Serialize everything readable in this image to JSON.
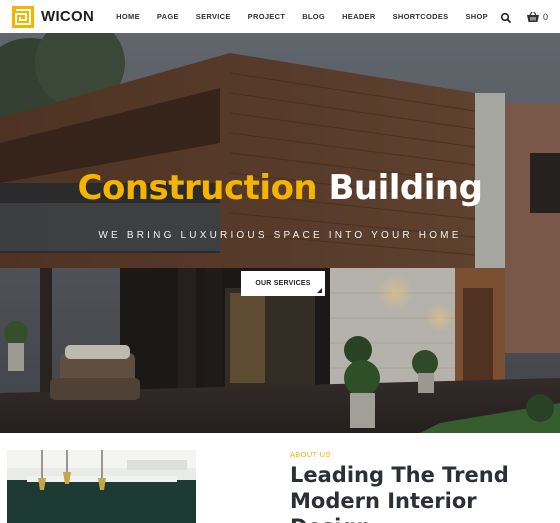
{
  "header": {
    "logo_text": "WICON",
    "logo_icon": "wicon-logo-mark",
    "nav": [
      "HOME",
      "PAGE",
      "SERVICE",
      "PROJECT",
      "BLOG",
      "HEADER",
      "SHORTCODES",
      "SHOP"
    ],
    "cart_count": "0",
    "icons": [
      "search-icon",
      "shopping-basket-icon"
    ]
  },
  "hero": {
    "title_accent": "Construction",
    "title_rest": "Building",
    "subtitle": "WE BRING LUXURIOUS SPACE INTO YOUR HOME",
    "button_label": "OUR SERVICES"
  },
  "about": {
    "label": "ABOUT US",
    "heading_line1": "Leading The Trend",
    "heading_line2": "Modern Interior Design"
  },
  "colors": {
    "accent": "#f5b400",
    "heading": "#2b2f36"
  }
}
